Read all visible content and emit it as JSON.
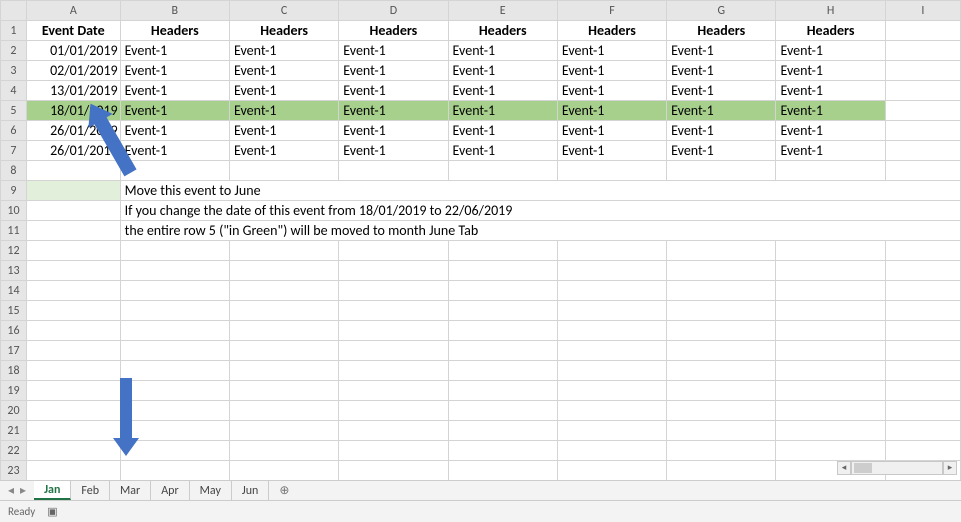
{
  "columns": [
    "A",
    "B",
    "C",
    "D",
    "E",
    "F",
    "G",
    "H",
    "I"
  ],
  "row_numbers": [
    1,
    2,
    3,
    4,
    5,
    6,
    7,
    8,
    9,
    10,
    11,
    12,
    13,
    14,
    15,
    16,
    17,
    18,
    19,
    20,
    21,
    22,
    23
  ],
  "header_row": {
    "A": "Event Date",
    "B": "Headers",
    "C": "Headers",
    "D": "Headers",
    "E": "Headers",
    "F": "Headers",
    "G": "Headers",
    "H": "Headers"
  },
  "data_rows": [
    {
      "date": "01/01/2019",
      "v": "Event-1"
    },
    {
      "date": "02/01/2019",
      "v": "Event-1"
    },
    {
      "date": "13/01/2019",
      "v": "Event-1"
    },
    {
      "date": "18/01/2019",
      "v": "Event-1",
      "hl": true
    },
    {
      "date": "26/01/2019",
      "v": "Event-1"
    },
    {
      "date": "26/01/2019",
      "v": "Event-1"
    }
  ],
  "notes": {
    "r9": "Move this event to June",
    "r10": "If you change the date of this event from 18/01/2019   to   22/06/2019",
    "r11": "the entire row 5 (\"in Green\") will be moved to month June Tab"
  },
  "tabs": [
    "Jan",
    "Feb",
    "Mar",
    "Apr",
    "May",
    "Jun"
  ],
  "active_tab": "Jan",
  "nav": {
    "first": "|◂",
    "prev": "◂",
    "next": "▸",
    "last": "▸|"
  },
  "add_tab": "⊕",
  "status": {
    "ready": "Ready"
  },
  "scroll": {
    "left": "◂",
    "right": "▸"
  }
}
